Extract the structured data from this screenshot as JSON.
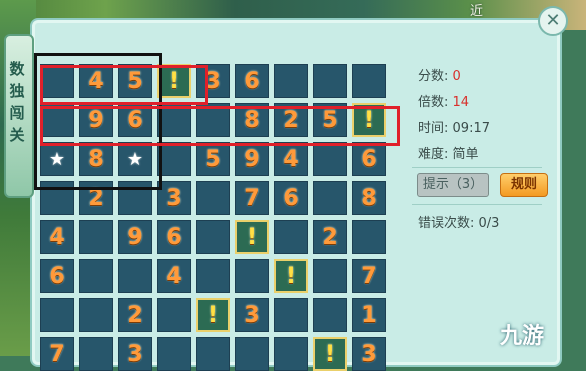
{
  "window": {
    "close_label": "✕",
    "top_text": "近"
  },
  "side_tab": {
    "title": "数独闯关"
  },
  "grid": {
    "rows": [
      [
        {
          "v": ""
        },
        {
          "v": "4"
        },
        {
          "v": "5"
        },
        {
          "v": "!",
          "h": true
        },
        {
          "v": "3"
        },
        {
          "v": "6"
        },
        {
          "v": ""
        },
        {
          "v": ""
        },
        {
          "v": ""
        }
      ],
      [
        {
          "v": ""
        },
        {
          "v": "9"
        },
        {
          "v": "6"
        },
        {
          "v": ""
        },
        {
          "v": ""
        },
        {
          "v": "8"
        },
        {
          "v": "2"
        },
        {
          "v": "5"
        },
        {
          "v": "!",
          "h": true
        }
      ],
      [
        {
          "v": "★",
          "s": true
        },
        {
          "v": "8"
        },
        {
          "v": "★",
          "s": true
        },
        {
          "v": ""
        },
        {
          "v": "5"
        },
        {
          "v": "9"
        },
        {
          "v": "4"
        },
        {
          "v": ""
        },
        {
          "v": "6"
        }
      ],
      [
        {
          "v": ""
        },
        {
          "v": "2"
        },
        {
          "v": ""
        },
        {
          "v": "3"
        },
        {
          "v": ""
        },
        {
          "v": "7"
        },
        {
          "v": "6"
        },
        {
          "v": ""
        },
        {
          "v": "8"
        }
      ],
      [
        {
          "v": "4"
        },
        {
          "v": ""
        },
        {
          "v": "9"
        },
        {
          "v": "6"
        },
        {
          "v": ""
        },
        {
          "v": "!",
          "h": true
        },
        {
          "v": ""
        },
        {
          "v": "2"
        },
        {
          "v": ""
        }
      ],
      [
        {
          "v": "6"
        },
        {
          "v": ""
        },
        {
          "v": ""
        },
        {
          "v": "4"
        },
        {
          "v": ""
        },
        {
          "v": ""
        },
        {
          "v": "!",
          "h": true
        },
        {
          "v": ""
        },
        {
          "v": "7"
        }
      ],
      [
        {
          "v": ""
        },
        {
          "v": ""
        },
        {
          "v": "2"
        },
        {
          "v": ""
        },
        {
          "v": "!",
          "h": true
        },
        {
          "v": "3"
        },
        {
          "v": ""
        },
        {
          "v": ""
        },
        {
          "v": "1"
        }
      ],
      [
        {
          "v": "7"
        },
        {
          "v": ""
        },
        {
          "v": "3"
        },
        {
          "v": ""
        },
        {
          "v": ""
        },
        {
          "v": ""
        },
        {
          "v": ""
        },
        {
          "v": "!",
          "h": true
        },
        {
          "v": "3"
        }
      ]
    ]
  },
  "info": {
    "score_label": "分数:",
    "score_value": "0",
    "multiplier_label": "倍数:",
    "multiplier_value": "14",
    "time_label": "时间:",
    "time_value": "09:17",
    "difficulty_label": "难度:",
    "difficulty_value": "简单"
  },
  "buttons": {
    "hint_label": "提示（3）",
    "rules_label": "规则"
  },
  "errors": {
    "label": "错误次数:",
    "value": "0/3"
  },
  "watermark": {
    "text": "九游"
  }
}
